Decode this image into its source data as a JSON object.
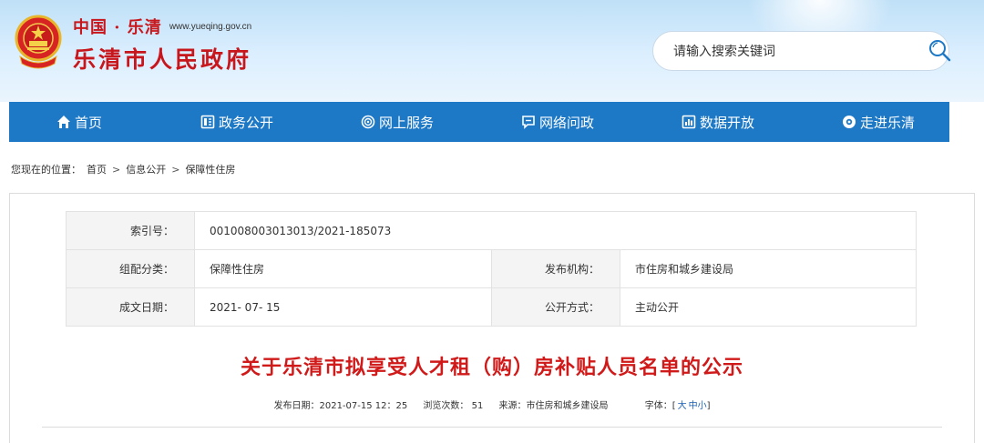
{
  "header": {
    "logo_line1": "中国 · 乐清",
    "logo_url": "www.yueqing.gov.cn",
    "logo_line2": "乐清市人民政府",
    "emblem_icon": "national-emblem-icon",
    "search_placeholder": "请输入搜索关键词",
    "search_icon": "search-icon"
  },
  "nav": {
    "items": [
      {
        "label": "首页",
        "icon": "home-icon"
      },
      {
        "label": "政务公开",
        "icon": "document-icon"
      },
      {
        "label": "网上服务",
        "icon": "service-icon"
      },
      {
        "label": "网络问政",
        "icon": "chat-icon"
      },
      {
        "label": "数据开放",
        "icon": "data-icon"
      },
      {
        "label": "走进乐清",
        "icon": "eye-icon"
      }
    ],
    "bg_color": "#1d78c6"
  },
  "breadcrumb": {
    "prefix": "您现在的位置：",
    "items": [
      "首页",
      "信息公开",
      "保障性住房"
    ],
    "sep": ">"
  },
  "meta": {
    "index_label": "索引号：",
    "index_value": "001008003013013/2021-185073",
    "category_label": "组配分类：",
    "category_value": "保障性住房",
    "publisher_label": "发布机构：",
    "publisher_value": "市住房和城乡建设局",
    "date_label": "成文日期：",
    "date_value": "2021- 07- 15",
    "mode_label": "公开方式：",
    "mode_value": "主动公开"
  },
  "article": {
    "title": "关于乐清市拟享受人才租（购）房补贴人员名单的公示",
    "publish_date": "发布日期：2021-07-15 12：25",
    "views": "浏览次数： 51",
    "source": "来源：市住房和城乡建设局",
    "font_label": "字体：[",
    "font_large": "大",
    "font_medium": "中",
    "font_small": "小",
    "font_close": "]",
    "title_color": "#d01a1a"
  }
}
